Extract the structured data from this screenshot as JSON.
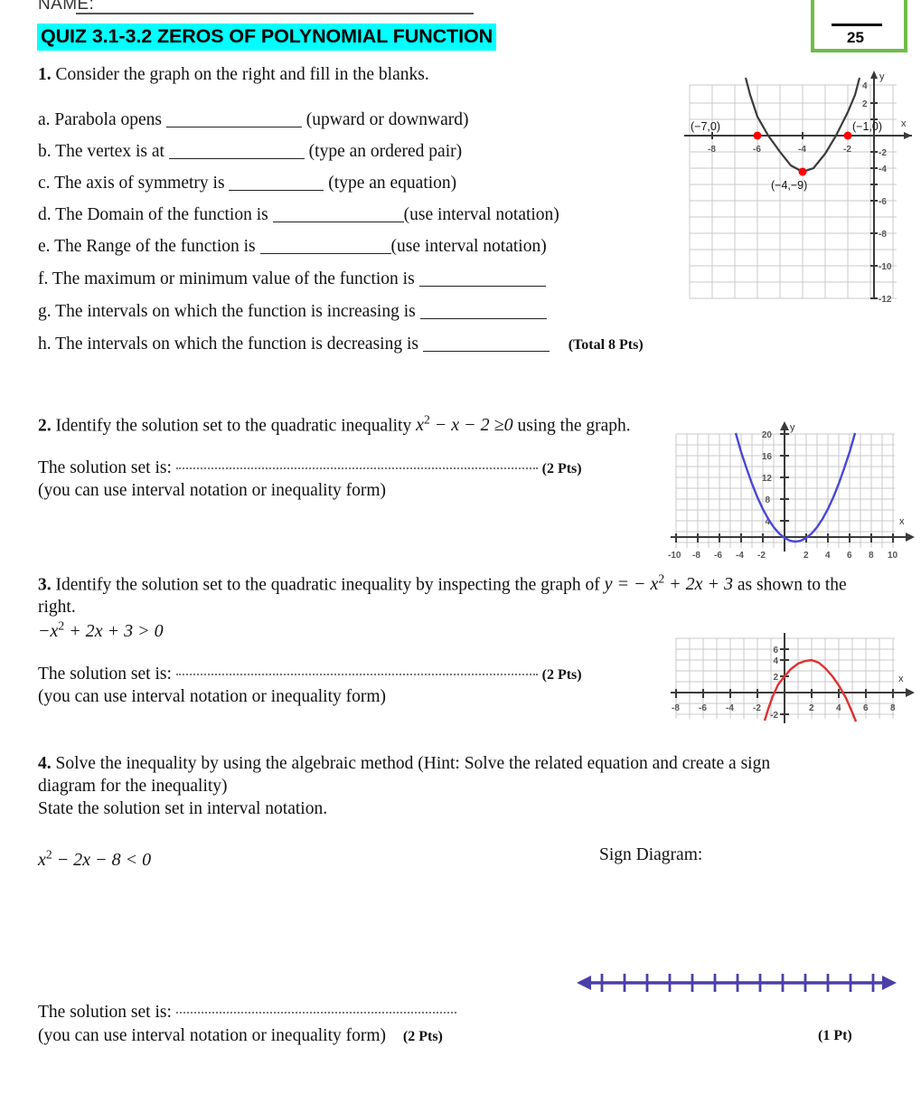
{
  "header": {
    "name_label": "NAME:",
    "title": "QUIZ 3.1-3.2 ZEROS OF POLYNOMIAL FUNCTION",
    "score_total": "25",
    "highlight_color": "#00ffff",
    "score_box_border_color": "#6fbd47"
  },
  "q1": {
    "number": "1.",
    "stem": "Consider the graph on the right and fill in the blanks.",
    "items": [
      {
        "label": "a.",
        "text": "Parabola opens",
        "hint": "(upward or downward)",
        "blank_width": 150
      },
      {
        "label": "b.",
        "text": "The vertex is at",
        "hint": "(type an ordered pair)",
        "blank_width": 150
      },
      {
        "label": "c.",
        "text": "The axis of symmetry is",
        "hint": "(type an equation)",
        "blank_width": 105
      },
      {
        "label": "d.",
        "text": "The Domain of the function is",
        "hint": "(use interval notation)",
        "blank_width": 145
      },
      {
        "label": "e.",
        "text": "The Range of the function is",
        "hint": "(use interval notation)",
        "blank_width": 145
      },
      {
        "label": "f.",
        "text": "The maximum or minimum value of the function is",
        "hint": "",
        "blank_width": 140
      },
      {
        "label": "g.",
        "text": "The intervals on which the function is increasing is",
        "hint": "",
        "blank_width": 140
      },
      {
        "label": "h.",
        "text": "The intervals on which the function is decreasing is",
        "hint": "",
        "blank_width": 140
      }
    ],
    "points": "(Total 8 Pts)"
  },
  "q2": {
    "number": "2.",
    "stem_before": "Identify the solution set to the quadratic inequality",
    "expression": "x² − x − 2 ≥0",
    "stem_after": "using the graph.",
    "answer_label": "The solution set is:",
    "note": "(you can use interval notation or inequality form)",
    "points": "(2 Pts)"
  },
  "q3": {
    "number": "3.",
    "stem_before": "Identify the solution set to the quadratic inequality by inspecting the graph of",
    "equation": "y = − x² + 2x + 3",
    "stem_after": "as shown to the right.",
    "inequality": "−x² + 2x + 3 > 0",
    "answer_label": "The solution set is:",
    "note": "(you can use interval notation or inequality form)",
    "points": "(2 Pts)"
  },
  "q4": {
    "number": "4.",
    "stem_line1": "Solve the inequality by using the algebraic method (Hint: Solve the related equation and create a sign",
    "stem_line2": "diagram for the inequality)",
    "stem_line3": "State the solution set in interval notation.",
    "inequality": "x² − 2x − 8 < 0",
    "sign_diagram_label": "Sign Diagram:",
    "answer_label": "The solution set is:",
    "note": "(you can use interval notation or inequality form)",
    "points": "(2 Pts)",
    "number_line_points": "(1 Pt)",
    "number_line_ticks": 13,
    "number_line_color": "#4b3fa8"
  },
  "chart_data": [
    {
      "id": "graph1",
      "type": "line",
      "title": "",
      "curve": "upward parabola y = (x+4)^2 - 9",
      "color": "#3a3a3a",
      "point_color": "#ff0000",
      "xlabel": "x",
      "ylabel": "y",
      "xlim": [
        -9,
        -0.3
      ],
      "ylim": [
        -12.5,
        4.5
      ],
      "xticks": [
        -8,
        -6,
        -4,
        -2
      ],
      "yticks": [
        4,
        2,
        -2,
        -4,
        -6,
        -8,
        -10,
        -12
      ],
      "xticklabels": [
        "-8",
        "-6",
        "-4",
        "-2"
      ],
      "yticklabels": [
        "4",
        "2",
        "-2",
        "-4",
        "-6",
        "-8",
        "-10",
        "-12"
      ],
      "grid": true,
      "points": [
        {
          "x": -7,
          "y": 0,
          "label": "(−7,0)"
        },
        {
          "x": -1,
          "y": 0,
          "label": "(−1,0)"
        },
        {
          "x": -4,
          "y": -9,
          "label": "(−4,−9)"
        }
      ]
    },
    {
      "id": "graph2",
      "type": "line",
      "title": "",
      "curve": "upward parabola y = x^2 - x - 2",
      "color": "#4a46d6",
      "xlabel": "x",
      "ylabel": "y",
      "xlim": [
        -10,
        10
      ],
      "ylim": [
        -2,
        21
      ],
      "xticks": [
        -10,
        -8,
        -6,
        -4,
        -2,
        2,
        4,
        6,
        8,
        10
      ],
      "yticks": [
        4,
        8,
        12,
        16,
        20
      ],
      "xticklabels": [
        "-10",
        "-8",
        "-6",
        "-4",
        "-2",
        "2",
        "4",
        "6",
        "8",
        "10"
      ],
      "yticklabels": [
        "4",
        "8",
        "12",
        "16",
        "20"
      ],
      "grid": true,
      "roots": [
        -1,
        2
      ]
    },
    {
      "id": "graph3",
      "type": "line",
      "title": "",
      "curve": "downward parabola y = -x^2 + 2x + 3",
      "color": "#e03030",
      "xlabel": "x",
      "ylabel": "y",
      "xlim": [
        -8.5,
        8.5
      ],
      "ylim": [
        -2.5,
        7
      ],
      "xticks": [
        -8,
        -6,
        -4,
        -2,
        2,
        4,
        6,
        8
      ],
      "yticks": [
        6,
        4,
        2,
        -2
      ],
      "xticklabels": [
        "-8",
        "-6",
        "-4",
        "-2",
        "2",
        "4",
        "6",
        "8"
      ],
      "yticklabels": [
        "6",
        "4",
        "2",
        "-2"
      ],
      "grid": true,
      "vertex": {
        "x": 1,
        "y": 4
      },
      "roots": [
        -1,
        3
      ]
    }
  ]
}
